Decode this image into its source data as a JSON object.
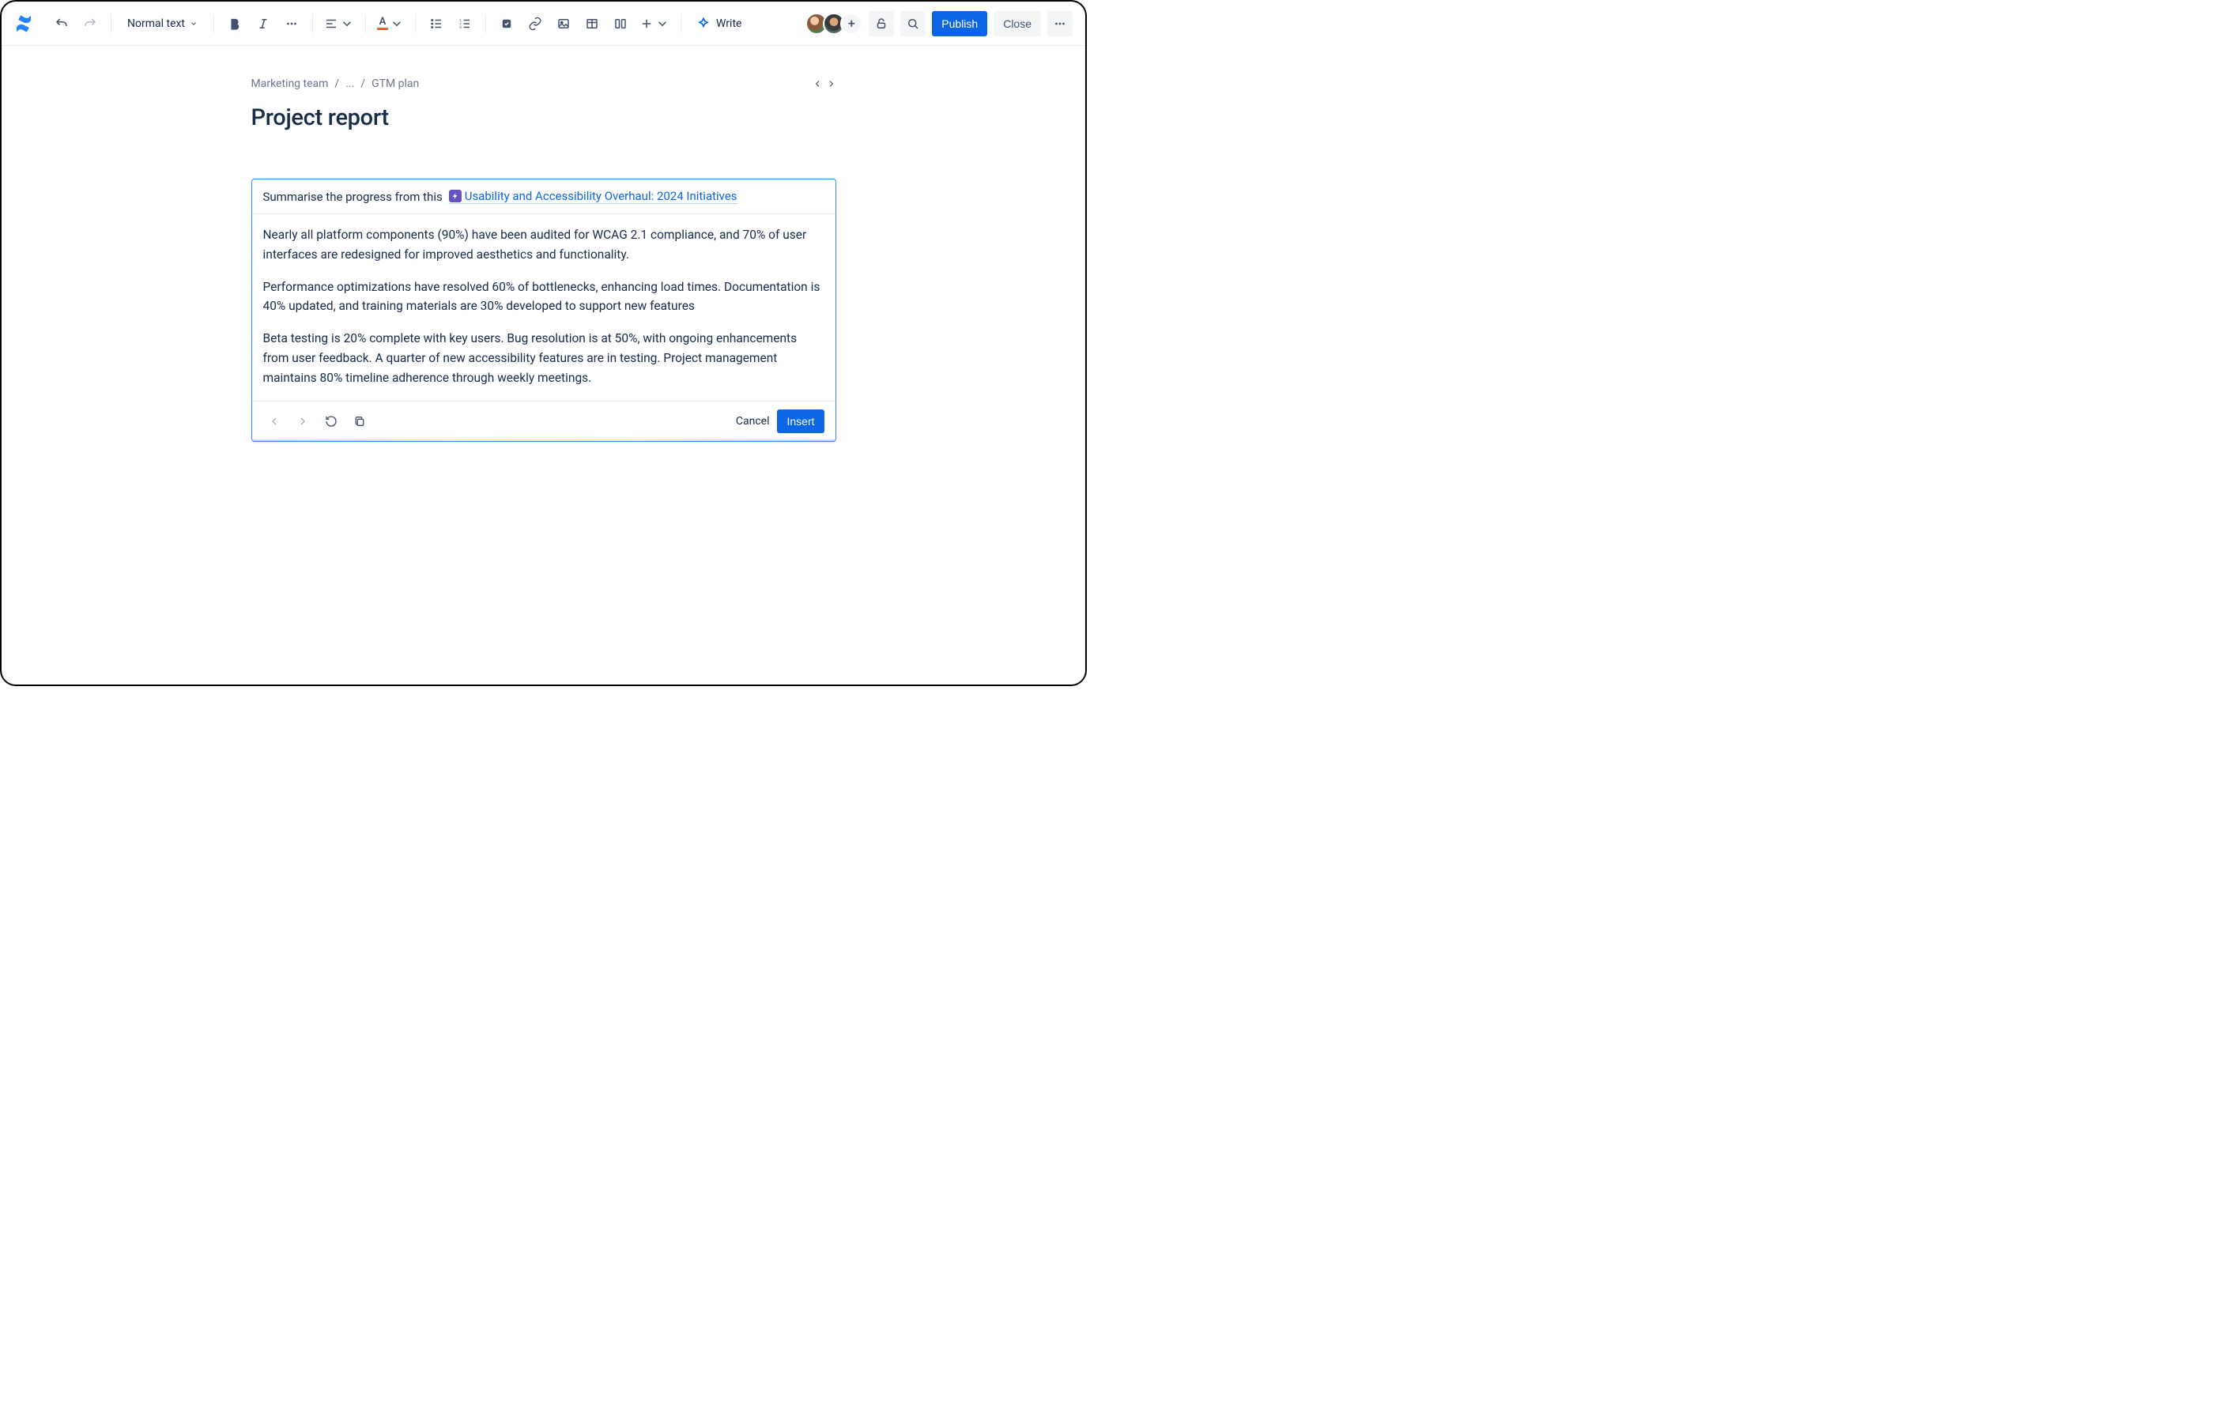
{
  "toolbar": {
    "text_style": "Normal text",
    "write_label": "Write",
    "publish_label": "Publish",
    "close_label": "Close"
  },
  "breadcrumb": {
    "space": "Marketing team",
    "ellipsis": "...",
    "page": "GTM plan"
  },
  "page": {
    "title": "Project report"
  },
  "ai": {
    "prompt_prefix": "Summarise the progress from this",
    "link_text": "Usability and Accessibility Overhaul: 2024 Initiatives",
    "paragraphs": {
      "p1": "Nearly all platform components (90%) have been audited for WCAG 2.1 compliance, and 70% of user interfaces are redesigned for improved aesthetics and functionality.",
      "p2": "Performance optimizations have resolved 60% of bottlenecks, enhancing load times. Documentation is 40% updated, and training materials are 30% developed to support new features",
      "p3": "Beta testing is 20% complete with key users. Bug resolution is at 50%, with ongoing enhancements from user feedback. A quarter of new accessibility features are in testing. Project management maintains 80% timeline adherence through weekly meetings."
    },
    "cancel_label": "Cancel",
    "insert_label": "Insert"
  }
}
